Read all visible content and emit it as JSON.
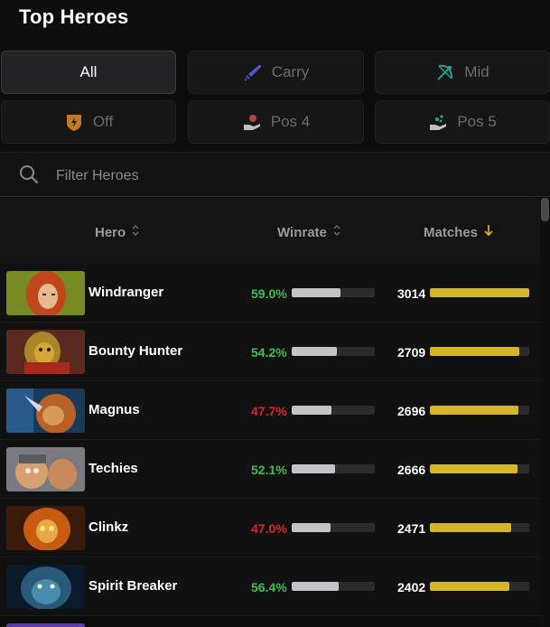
{
  "title": "Top Heroes",
  "tabs": [
    {
      "label": "All",
      "icon": "none",
      "active": true
    },
    {
      "label": "Carry",
      "icon": "sword-icon",
      "active": false
    },
    {
      "label": "Mid",
      "icon": "bow-icon",
      "active": false
    },
    {
      "label": "Off",
      "icon": "shield-icon",
      "active": false
    },
    {
      "label": "Pos 4",
      "icon": "support-hand-icon",
      "active": false
    },
    {
      "label": "Pos 5",
      "icon": "hard-support-hand-icon",
      "active": false
    }
  ],
  "filter": {
    "placeholder": "Filter Heroes",
    "value": ""
  },
  "columns": {
    "hero": "Hero",
    "winrate": "Winrate",
    "matches": "Matches",
    "sort_by": "matches",
    "sort_dir": "desc"
  },
  "colors": {
    "positive": "#3fbf52",
    "negative": "#e0222c",
    "winrate_bar": "#c4c4c8",
    "matches_bar": "#d4b52c",
    "sort_arrow": "#e0b830"
  },
  "rows": [
    {
      "name": "Windranger",
      "winrate": "59.0%",
      "winrate_value": 59.0,
      "matches": "3014",
      "matches_value": 3014,
      "positive": true
    },
    {
      "name": "Bounty Hunter",
      "winrate": "54.2%",
      "winrate_value": 54.2,
      "matches": "2709",
      "matches_value": 2709,
      "positive": true
    },
    {
      "name": "Magnus",
      "winrate": "47.7%",
      "winrate_value": 47.7,
      "matches": "2696",
      "matches_value": 2696,
      "positive": false
    },
    {
      "name": "Techies",
      "winrate": "52.1%",
      "winrate_value": 52.1,
      "matches": "2666",
      "matches_value": 2666,
      "positive": true
    },
    {
      "name": "Clinkz",
      "winrate": "47.0%",
      "winrate_value": 47.0,
      "matches": "2471",
      "matches_value": 2471,
      "positive": false
    },
    {
      "name": "Spirit Breaker",
      "winrate": "56.4%",
      "winrate_value": 56.4,
      "matches": "2402",
      "matches_value": 2402,
      "positive": true
    }
  ]
}
